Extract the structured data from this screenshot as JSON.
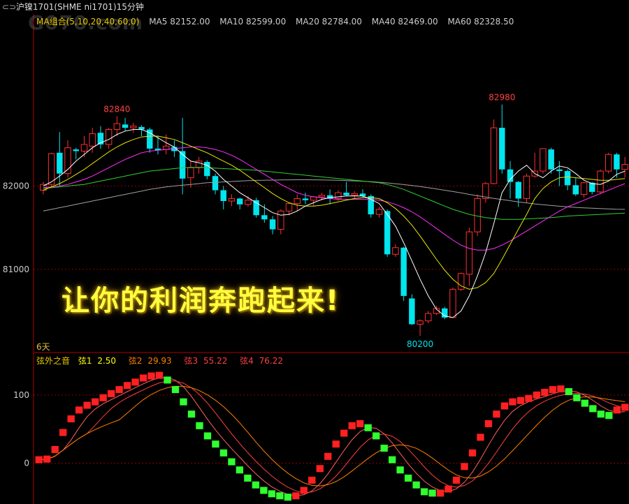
{
  "title": "沪镍1701(SHME ni1701)15分钟",
  "watermark": "G070.com",
  "ma_header": {
    "label": "MA组合(5,10,20,40,60,0)",
    "items": [
      {
        "text": "MA5 82152.00",
        "color": "#ffffff"
      },
      {
        "text": "MA10 82599.00",
        "color": "#e6e600"
      },
      {
        "text": "MA20 82784.00",
        "color": "#ff30ff"
      },
      {
        "text": "MA40 82469.00",
        "color": "#30d030"
      },
      {
        "text": "MA60 82328.50",
        "color": "#a0a0a0"
      }
    ]
  },
  "osc_header": {
    "name": "弦外之音",
    "items": [
      {
        "label": "弦1",
        "value": "2.50",
        "color": "#ffff00"
      },
      {
        "label": "弦2",
        "value": "29.93",
        "color": "#ff8000"
      },
      {
        "label": "弦3",
        "value": "55.22",
        "color": "#ff4040"
      },
      {
        "label": "弦4",
        "value": "76.22",
        "color": "#ff4040"
      }
    ]
  },
  "slogan": "让你的利润奔跑起来!",
  "days_label": "6天",
  "colors": {
    "up": "#ff3030",
    "down": "#00e5ee",
    "grid": "#8b0000",
    "axis": "#b00000",
    "osc_up": "#ff2020",
    "osc_down": "#30ff30"
  },
  "chart_data": {
    "type": "candlestick",
    "yaxis_labels": [
      82000,
      81000
    ],
    "ylim": [
      80000,
      83900
    ],
    "annotations": [
      {
        "text": "82840",
        "value": 82840
      },
      {
        "text": "82980",
        "value": 82980
      },
      {
        "text": "80200",
        "value": 80200
      }
    ],
    "candles": [
      [
        81950,
        82050,
        81900,
        82020
      ],
      [
        82020,
        82400,
        81990,
        82390
      ],
      [
        82400,
        82650,
        82000,
        82150
      ],
      [
        82150,
        82550,
        82100,
        82460
      ],
      [
        82440,
        82460,
        82320,
        82420
      ],
      [
        82420,
        82600,
        82350,
        82500
      ],
      [
        82480,
        82700,
        82400,
        82630
      ],
      [
        82640,
        82720,
        82450,
        82500
      ],
      [
        82500,
        82700,
        82450,
        82680
      ],
      [
        82680,
        82840,
        82600,
        82750
      ],
      [
        82740,
        82820,
        82660,
        82700
      ],
      [
        82700,
        82760,
        82640,
        82720
      ],
      [
        82710,
        82730,
        82600,
        82680
      ],
      [
        82680,
        82700,
        82400,
        82450
      ],
      [
        82450,
        82600,
        82380,
        82430
      ],
      [
        82440,
        82620,
        82380,
        82480
      ],
      [
        82470,
        82550,
        82350,
        82420
      ],
      [
        82420,
        82820,
        81900,
        82090
      ],
      [
        82100,
        82300,
        81980,
        82220
      ],
      [
        82220,
        82350,
        82150,
        82300
      ],
      [
        82290,
        82310,
        82080,
        82120
      ],
      [
        82120,
        82150,
        81900,
        81950
      ],
      [
        81950,
        82000,
        81720,
        81820
      ],
      [
        81820,
        81900,
        81760,
        81850
      ],
      [
        81850,
        81860,
        81720,
        81780
      ],
      [
        81780,
        81880,
        81750,
        81830
      ],
      [
        81830,
        81860,
        81620,
        81650
      ],
      [
        81650,
        81780,
        81560,
        81600
      ],
      [
        81600,
        81640,
        81420,
        81480
      ],
      [
        81480,
        81720,
        81420,
        81700
      ],
      [
        81700,
        81800,
        81650,
        81790
      ],
      [
        81790,
        81900,
        81700,
        81850
      ],
      [
        81850,
        81920,
        81780,
        81830
      ],
      [
        81830,
        81880,
        81760,
        81870
      ],
      [
        81870,
        81920,
        81830,
        81890
      ],
      [
        81890,
        81960,
        81780,
        81850
      ],
      [
        81850,
        81950,
        81820,
        81920
      ],
      [
        81920,
        82050,
        81880,
        81890
      ],
      [
        81890,
        81940,
        81850,
        81910
      ],
      [
        81910,
        81960,
        81860,
        81880
      ],
      [
        81880,
        81900,
        81620,
        81660
      ],
      [
        81660,
        81750,
        81620,
        81720
      ],
      [
        81700,
        81720,
        81150,
        81180
      ],
      [
        81180,
        81300,
        81150,
        81260
      ],
      [
        81260,
        81270,
        80620,
        80680
      ],
      [
        80650,
        80700,
        80330,
        80340
      ],
      [
        80340,
        80400,
        80200,
        80380
      ],
      [
        80380,
        80500,
        80350,
        80470
      ],
      [
        80470,
        80560,
        80450,
        80530
      ],
      [
        80530,
        80550,
        80400,
        80420
      ],
      [
        80420,
        80780,
        80420,
        80760
      ],
      [
        80760,
        80960,
        80740,
        80950
      ],
      [
        80940,
        81500,
        80800,
        81450
      ],
      [
        81450,
        81900,
        81400,
        81850
      ],
      [
        81850,
        82050,
        81800,
        82030
      ],
      [
        82030,
        82800,
        82020,
        82700
      ],
      [
        82700,
        82980,
        82150,
        82200
      ],
      [
        82200,
        82300,
        81850,
        82050
      ],
      [
        82050,
        82060,
        81750,
        81850
      ],
      [
        81850,
        82150,
        81800,
        82120
      ],
      [
        82120,
        82400,
        82100,
        82180
      ],
      [
        82180,
        82450,
        82150,
        82450
      ],
      [
        82440,
        82460,
        82150,
        82200
      ],
      [
        82200,
        82300,
        82000,
        82180
      ],
      [
        82180,
        82200,
        81950,
        82010
      ],
      [
        82010,
        82100,
        81880,
        81900
      ],
      [
        81900,
        82050,
        81860,
        82040
      ],
      [
        82040,
        82050,
        81900,
        81930
      ],
      [
        81930,
        82200,
        81900,
        82180
      ],
      [
        82180,
        82400,
        82150,
        82380
      ],
      [
        82380,
        82400,
        82100,
        82200
      ],
      [
        82200,
        82350,
        82100,
        82260
      ]
    ],
    "ma5": [
      82000,
      82050,
      82120,
      82200,
      82300,
      82380,
      82460,
      82520,
      82560,
      82620,
      82660,
      82680,
      82680,
      82640,
      82580,
      82520,
      82470,
      82380,
      82300,
      82280,
      82250,
      82180,
      82080,
      82000,
      81920,
      81860,
      81800,
      81740,
      81680,
      81650,
      81660,
      81700,
      81760,
      81800,
      81840,
      81860,
      81870,
      81880,
      81880,
      81880,
      81840,
      81790,
      81660,
      81520,
      81320,
      81100,
      80880,
      80680,
      80520,
      80440,
      80420,
      80500,
      80680,
      80920,
      81200,
      81550,
      81920,
      82080,
      82180,
      82250,
      82150,
      82100,
      82180,
      82240,
      82220,
      82150,
      82070,
      82030,
      82020,
      82060,
      82140,
      82180
    ],
    "ma10": [
      81950,
      81990,
      82030,
      82080,
      82140,
      82200,
      82270,
      82340,
      82410,
      82470,
      82520,
      82560,
      82590,
      82600,
      82600,
      82580,
      82560,
      82520,
      82480,
      82440,
      82400,
      82350,
      82300,
      82250,
      82190,
      82120,
      82050,
      81980,
      81910,
      81850,
      81800,
      81770,
      81760,
      81760,
      81770,
      81790,
      81810,
      81830,
      81850,
      81860,
      81860,
      81850,
      81800,
      81730,
      81640,
      81530,
      81400,
      81260,
      81120,
      80990,
      80880,
      80800,
      80760,
      80780,
      80840,
      80950,
      81120,
      81300,
      81480,
      81660,
      81850,
      81970,
      82050,
      82100,
      82110,
      82100,
      82090,
      82080,
      82070,
      82070,
      82080,
      82090
    ],
    "ma20": [
      81980,
      81990,
      82000,
      82020,
      82050,
      82080,
      82120,
      82170,
      82220,
      82270,
      82320,
      82360,
      82400,
      82420,
      82430,
      82440,
      82450,
      82460,
      82470,
      82470,
      82460,
      82440,
      82410,
      82370,
      82320,
      82260,
      82200,
      82140,
      82080,
      82020,
      81970,
      81920,
      81890,
      81870,
      81860,
      81850,
      81840,
      81840,
      81840,
      81840,
      81840,
      81830,
      81810,
      81780,
      81740,
      81690,
      81630,
      81560,
      81490,
      81420,
      81350,
      81290,
      81250,
      81230,
      81230,
      81250,
      81290,
      81340,
      81400,
      81460,
      81520,
      81580,
      81640,
      81700,
      81750,
      81790,
      81830,
      81870,
      81910,
      81950,
      81990,
      82030
    ],
    "ma40": [
      81970,
      81980,
      81990,
      82000,
      82010,
      82020,
      82040,
      82060,
      82080,
      82100,
      82120,
      82140,
      82160,
      82180,
      82190,
      82200,
      82210,
      82220,
      82225,
      82225,
      82220,
      82215,
      82210,
      82205,
      82200,
      82195,
      82190,
      82180,
      82170,
      82160,
      82150,
      82140,
      82130,
      82120,
      82110,
      82100,
      82090,
      82080,
      82070,
      82060,
      82050,
      82040,
      82020,
      81990,
      81960,
      81920,
      81880,
      81840,
      81800,
      81760,
      81720,
      81690,
      81660,
      81640,
      81620,
      81610,
      81600,
      81600,
      81600,
      81605,
      81610,
      81615,
      81620,
      81630,
      81640,
      81645,
      81650,
      81655,
      81660,
      81665,
      81670,
      81675
    ],
    "ma60": [
      81700,
      81720,
      81740,
      81760,
      81780,
      81800,
      81820,
      81840,
      81860,
      81880,
      81900,
      81920,
      81940,
      81960,
      81975,
      81990,
      82000,
      82010,
      82020,
      82030,
      82040,
      82045,
      82050,
      82055,
      82060,
      82065,
      82068,
      82070,
      82072,
      82074,
      82075,
      82076,
      82076,
      82075,
      82074,
      82072,
      82070,
      82066,
      82062,
      82058,
      82052,
      82046,
      82038,
      82028,
      82018,
      82006,
      81994,
      81980,
      81966,
      81950,
      81934,
      81918,
      81900,
      81884,
      81868,
      81852,
      81838,
      81824,
      81810,
      81798,
      81786,
      81776,
      81766,
      81758,
      81750,
      81744,
      81738,
      81734,
      81730,
      81726,
      81722,
      81720
    ],
    "osc": {
      "ylim": [
        -60,
        145
      ],
      "yaxis_labels": [
        100,
        0
      ],
      "values": [
        5,
        6,
        20,
        45,
        65,
        78,
        85,
        90,
        96,
        102,
        108,
        114,
        119,
        125,
        128,
        129,
        122,
        108,
        90,
        72,
        55,
        40,
        28,
        15,
        2,
        -10,
        -22,
        -32,
        -40,
        -45,
        -48,
        -50,
        -48,
        -40,
        -25,
        -8,
        10,
        28,
        44,
        55,
        58,
        52,
        40,
        22,
        5,
        -10,
        -22,
        -32,
        -42,
        -44,
        -44,
        -38,
        -25,
        -5,
        15,
        38,
        58,
        72,
        84,
        90,
        92,
        95,
        100,
        104,
        108,
        109,
        105,
        96,
        88,
        80,
        72,
        70,
        78,
        82
      ]
    }
  }
}
